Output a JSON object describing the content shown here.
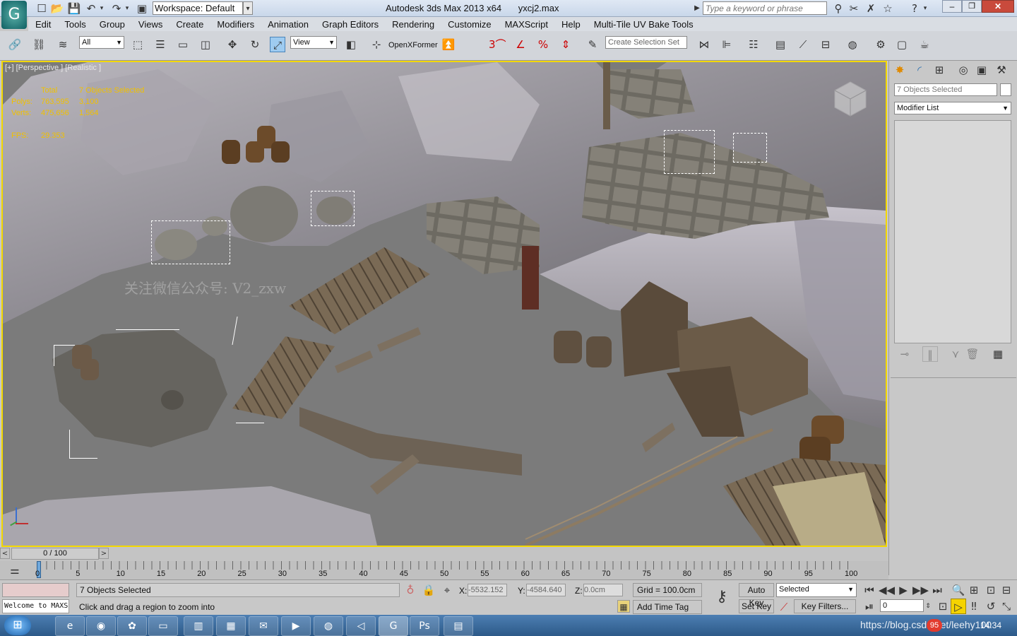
{
  "titlebar": {
    "workspace": "Workspace: Default",
    "app_title": "Autodesk 3ds Max  2013 x64",
    "file_name": "yxcj2.max",
    "search_placeholder": "Type a keyword or phrase"
  },
  "menu": [
    "Edit",
    "Tools",
    "Group",
    "Views",
    "Create",
    "Modifiers",
    "Animation",
    "Graph Editors",
    "Rendering",
    "Customize",
    "MAXScript",
    "Help",
    "Multi-Tile UV Bake Tools"
  ],
  "toolbar": {
    "filter_value": "All",
    "refcoord_value": "View",
    "openxformer_label": "OpenXFormer",
    "selection_set_placeholder": "Create Selection Set"
  },
  "viewport": {
    "label": "[+] [Perspective ] [Realistic ]",
    "stats": {
      "total_label": "Total",
      "selected_label": "7 Objects Selected",
      "polys_label": "Polys:",
      "polys_total": "763,595",
      "polys_sel": "3,100",
      "verts_label": "Verts:",
      "verts_total": "475,656",
      "verts_sel": "1,564",
      "fps_label": "FPS:",
      "fps_value": "29.353"
    },
    "watermark": "关注微信公众号: V2_zxw"
  },
  "cmdpanel": {
    "object_name": "7 Objects Selected",
    "modifier_list": "Modifier List"
  },
  "timeslider": {
    "frame_label": "0 / 100",
    "ticks": [
      "0",
      "5",
      "10",
      "15",
      "20",
      "25",
      "30",
      "35",
      "40",
      "45",
      "50",
      "55",
      "60",
      "65",
      "70",
      "75",
      "80",
      "85",
      "90",
      "95",
      "100"
    ]
  },
  "status": {
    "selection_info": "7 Objects Selected",
    "prompt": "Click and drag a region to zoom into",
    "listener": "Welcome to MAXS",
    "x_label": "X:",
    "x_value": "-5532.152",
    "y_label": "Y:",
    "y_value": "-4584.640",
    "z_label": "Z:",
    "z_value": "0.0cm",
    "grid": "Grid = 100.0cm",
    "add_time_tag": "Add Time Tag",
    "auto_key": "Auto Key",
    "set_key": "Set Key",
    "key_mode_value": "Selected",
    "key_filters": "Key Filters...",
    "frame_value": "0"
  },
  "taskbar": {
    "tray_text": "https://blog.csdn.net/leehy100",
    "clock": "14:34",
    "badge": "95"
  },
  "colors": {
    "viewport_border": "#f3d800",
    "stats_text": "#f0c000",
    "taskbar": "#2c5988"
  }
}
